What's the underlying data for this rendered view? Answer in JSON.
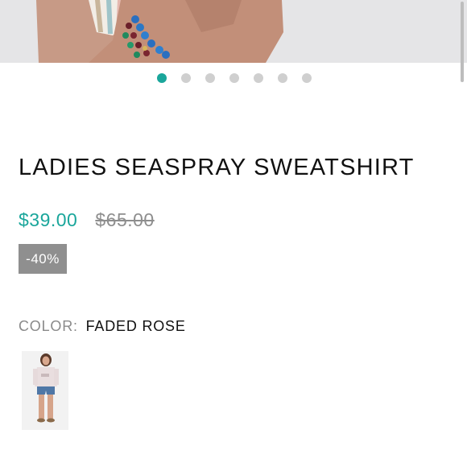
{
  "product": {
    "title": "LADIES SEASPRAY SWEATSHIRT",
    "price_sale": "$39.00",
    "price_original": "$65.00",
    "discount_badge": "-40%",
    "color_label": "COLOR:",
    "color_value": "FADED ROSE"
  },
  "carousel": {
    "slide_count": 7,
    "active_index": 0
  },
  "colors": {
    "accent": "#1aa69b",
    "badge_bg": "#8f8f8f",
    "strike_text": "#8e8e8e"
  },
  "icons": {
    "product_photo": "product-photo-image",
    "swatch": "color-swatch-image"
  }
}
